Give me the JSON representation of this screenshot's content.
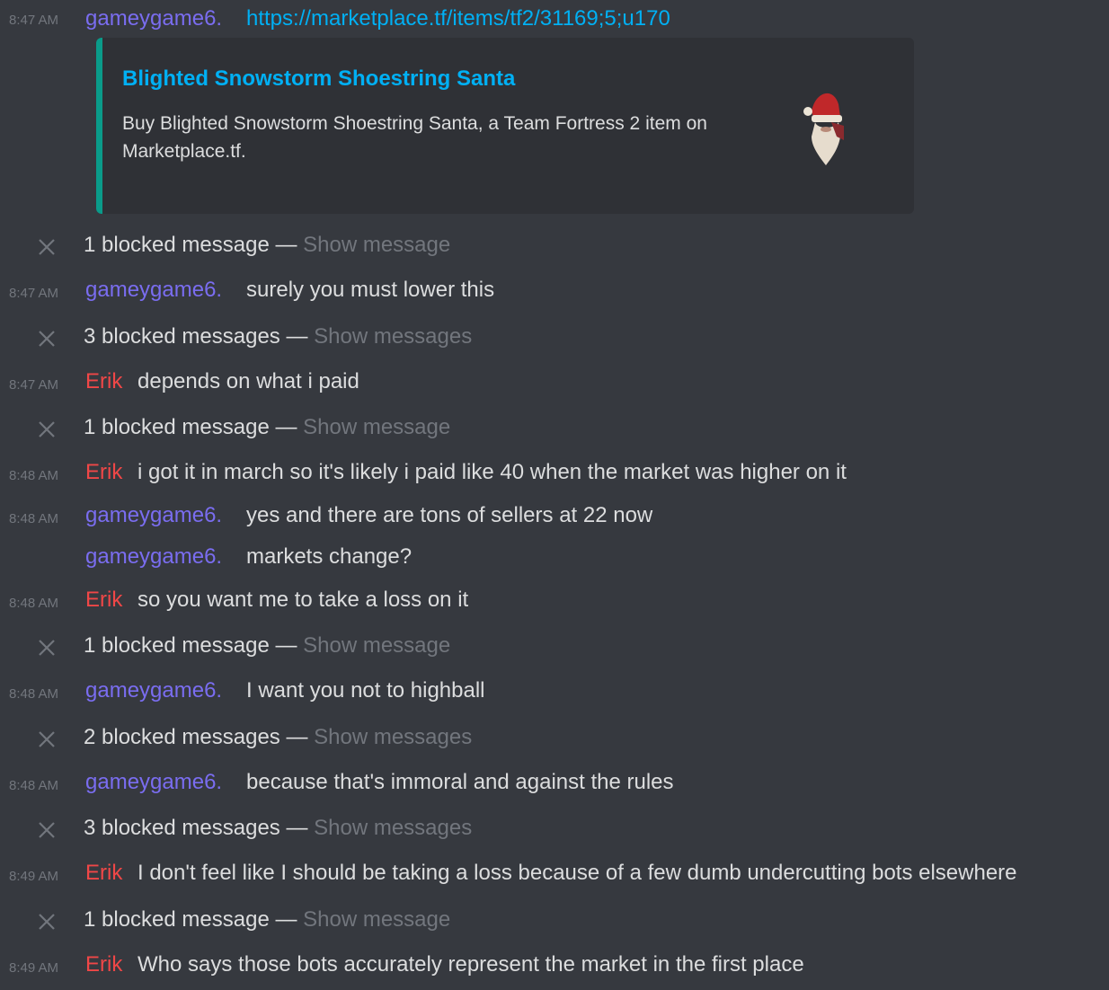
{
  "colors": {
    "background": "#36393f",
    "embed_background": "#2f3136",
    "embed_accent": "#0a9b8a",
    "link": "#00b0f4",
    "gameygame_name": "#7a6df0",
    "erik_name": "#f04747",
    "muted": "#72767d",
    "text": "#dcddde"
  },
  "messages": [
    {
      "time": "8:47 AM",
      "author": "gameygame6.",
      "link": "https://marketplace.tf/items/tf2/31169;5;u170"
    },
    {
      "blocked": "1 blocked message —",
      "show": "Show message"
    },
    {
      "time": "8:47 AM",
      "author": "gameygame6.",
      "text": "surely you must lower this"
    },
    {
      "blocked": "3 blocked messages —",
      "show": "Show messages"
    },
    {
      "time": "8:47 AM",
      "author": "Erik",
      "text": "depends on what i paid"
    },
    {
      "blocked": "1 blocked message —",
      "show": "Show message"
    },
    {
      "time": "8:48 AM",
      "author": "Erik",
      "text": "i got it in march so it's likely i paid like 40 when the market was higher on it"
    },
    {
      "time": "8:48 AM",
      "author": "gameygame6.",
      "text": "yes and there are tons of sellers at 22 now"
    },
    {
      "author": "gameygame6.",
      "text": "markets change?"
    },
    {
      "time": "8:48 AM",
      "author": "Erik",
      "text": "so you want me to take a loss on it"
    },
    {
      "blocked": "1 blocked message —",
      "show": "Show message"
    },
    {
      "time": "8:48 AM",
      "author": "gameygame6.",
      "text": "I want you not to highball"
    },
    {
      "blocked": "2 blocked messages —",
      "show": "Show messages"
    },
    {
      "time": "8:48 AM",
      "author": "gameygame6.",
      "text": "because that's immoral and against the rules"
    },
    {
      "blocked": "3 blocked messages —",
      "show": "Show messages"
    },
    {
      "time": "8:49 AM",
      "author": "Erik",
      "text": "I don't feel like I should be taking a loss because of a few dumb undercutting bots elsewhere"
    },
    {
      "blocked": "1 blocked message —",
      "show": "Show message"
    },
    {
      "time": "8:49 AM",
      "author": "Erik",
      "text": "Who says those bots accurately represent the market in the first place"
    }
  ],
  "embed": {
    "title": "Blighted Snowstorm Shoestring Santa",
    "description": "Buy Blighted Snowstorm Shoestring Santa, a Team Fortress 2 item on Marketplace.tf.",
    "thumbnail_icon": "santa-hat-beard-item-icon"
  }
}
